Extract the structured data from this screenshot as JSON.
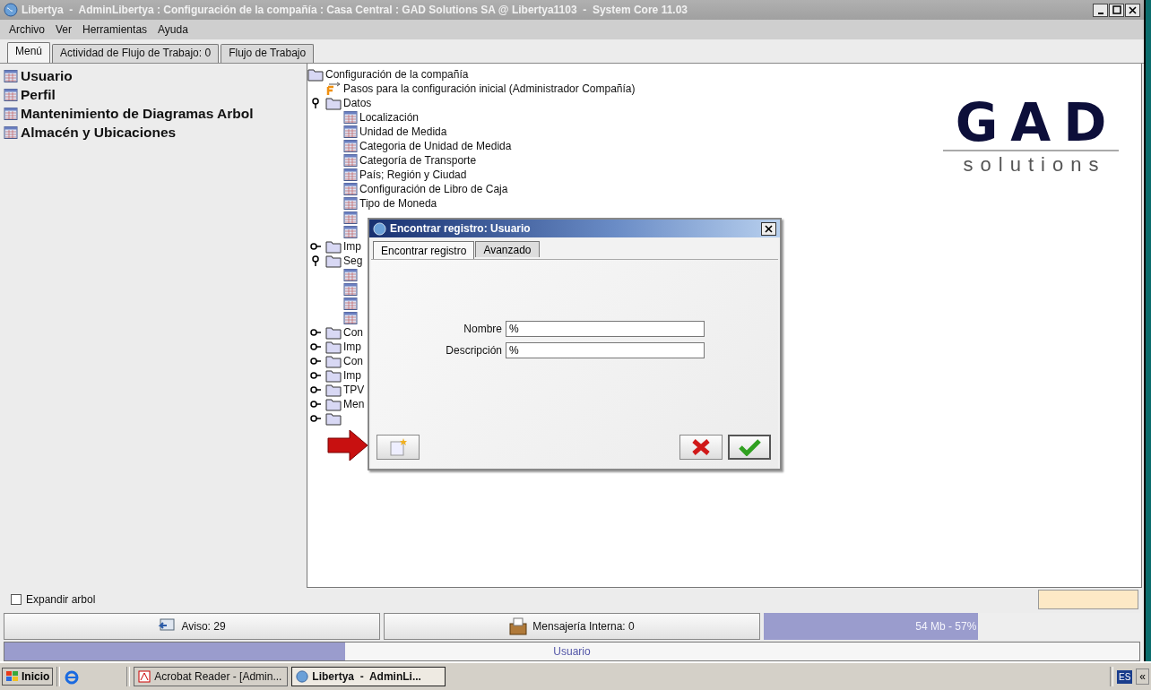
{
  "window": {
    "title": "Libertya  -  AdminLibertya : Configuración de la compañía : Casa Central : GAD Solutions SA @ Libertya1103  -  System Core 11.03"
  },
  "menu": [
    "Archivo",
    "Ver",
    "Herramientas",
    "Ayuda"
  ],
  "tabs": [
    {
      "label": "Menú",
      "selected": true
    },
    {
      "label": "Actividad de Flujo de Trabajo: 0",
      "selected": false
    },
    {
      "label": "Flujo de Trabajo",
      "selected": false
    }
  ],
  "favorites": [
    "Usuario",
    "Perfil",
    "Mantenimiento de Diagramas Arbol",
    "Almacén y Ubicaciones"
  ],
  "tree": {
    "label": "Configuración de la compañía",
    "children": [
      {
        "kind": "wizard",
        "label": "Pasos para la configuración inicial (Administrador Compañía)"
      },
      {
        "kind": "folder",
        "label": "Datos",
        "expanded": true,
        "children": [
          {
            "kind": "window",
            "label": "Localización"
          },
          {
            "kind": "window",
            "label": "Unidad de Medida"
          },
          {
            "kind": "window",
            "label": "Categoria de Unidad de Medida"
          },
          {
            "kind": "window",
            "label": "Categoría de Transporte"
          },
          {
            "kind": "window",
            "label": "País; Región y Ciudad"
          },
          {
            "kind": "window",
            "label": "Configuración de Libro de Caja"
          },
          {
            "kind": "window",
            "label": "Tipo de Moneda"
          },
          {
            "kind": "window"
          },
          {
            "kind": "window"
          }
        ]
      },
      {
        "kind": "folder",
        "label": "Imp",
        "expanded": false
      },
      {
        "kind": "folder",
        "label": "Seg",
        "expanded": true,
        "children": [
          {
            "kind": "window"
          },
          {
            "kind": "window"
          },
          {
            "kind": "window"
          },
          {
            "kind": "window"
          }
        ]
      },
      {
        "kind": "folder",
        "label": "Con",
        "expanded": false
      },
      {
        "kind": "folder",
        "label": "Imp",
        "expanded": false
      },
      {
        "kind": "folder",
        "label": "Con",
        "expanded": false
      },
      {
        "kind": "folder",
        "label": "Imp",
        "expanded": false
      },
      {
        "kind": "folder",
        "label": "TPV",
        "expanded": false
      },
      {
        "kind": "folder",
        "label": "Men",
        "expanded": false
      },
      {
        "kind": "folder",
        "expanded": false
      }
    ]
  },
  "logo": {
    "name": "GAD",
    "tagline": "solutions"
  },
  "dialog": {
    "title": "Encontrar registro: Usuario",
    "tabs": [
      {
        "label": "Encontrar registro",
        "selected": true
      },
      {
        "label": "Avanzado",
        "selected": false
      }
    ],
    "fields": [
      {
        "label": "Nombre",
        "value": "%"
      },
      {
        "label": "Descripción",
        "value": "%"
      }
    ]
  },
  "expand_tree": {
    "label": "Expandir arbol",
    "checked": false
  },
  "status": {
    "notices": "Aviso: 29",
    "messages": "Mensajería Interna: 0",
    "memory": {
      "reading": "54 Mb - 57%",
      "level": 0.57
    }
  },
  "progress": {
    "label": "Usuario",
    "level": 0.3
  },
  "taskbar": {
    "start": "Inicio",
    "tasks": [
      {
        "label": "Acrobat Reader - [Admin...",
        "selected": false
      },
      {
        "label": "Libertya  -  AdminLi...",
        "selected": true
      }
    ],
    "language": "ES",
    "tray_button": "«"
  }
}
